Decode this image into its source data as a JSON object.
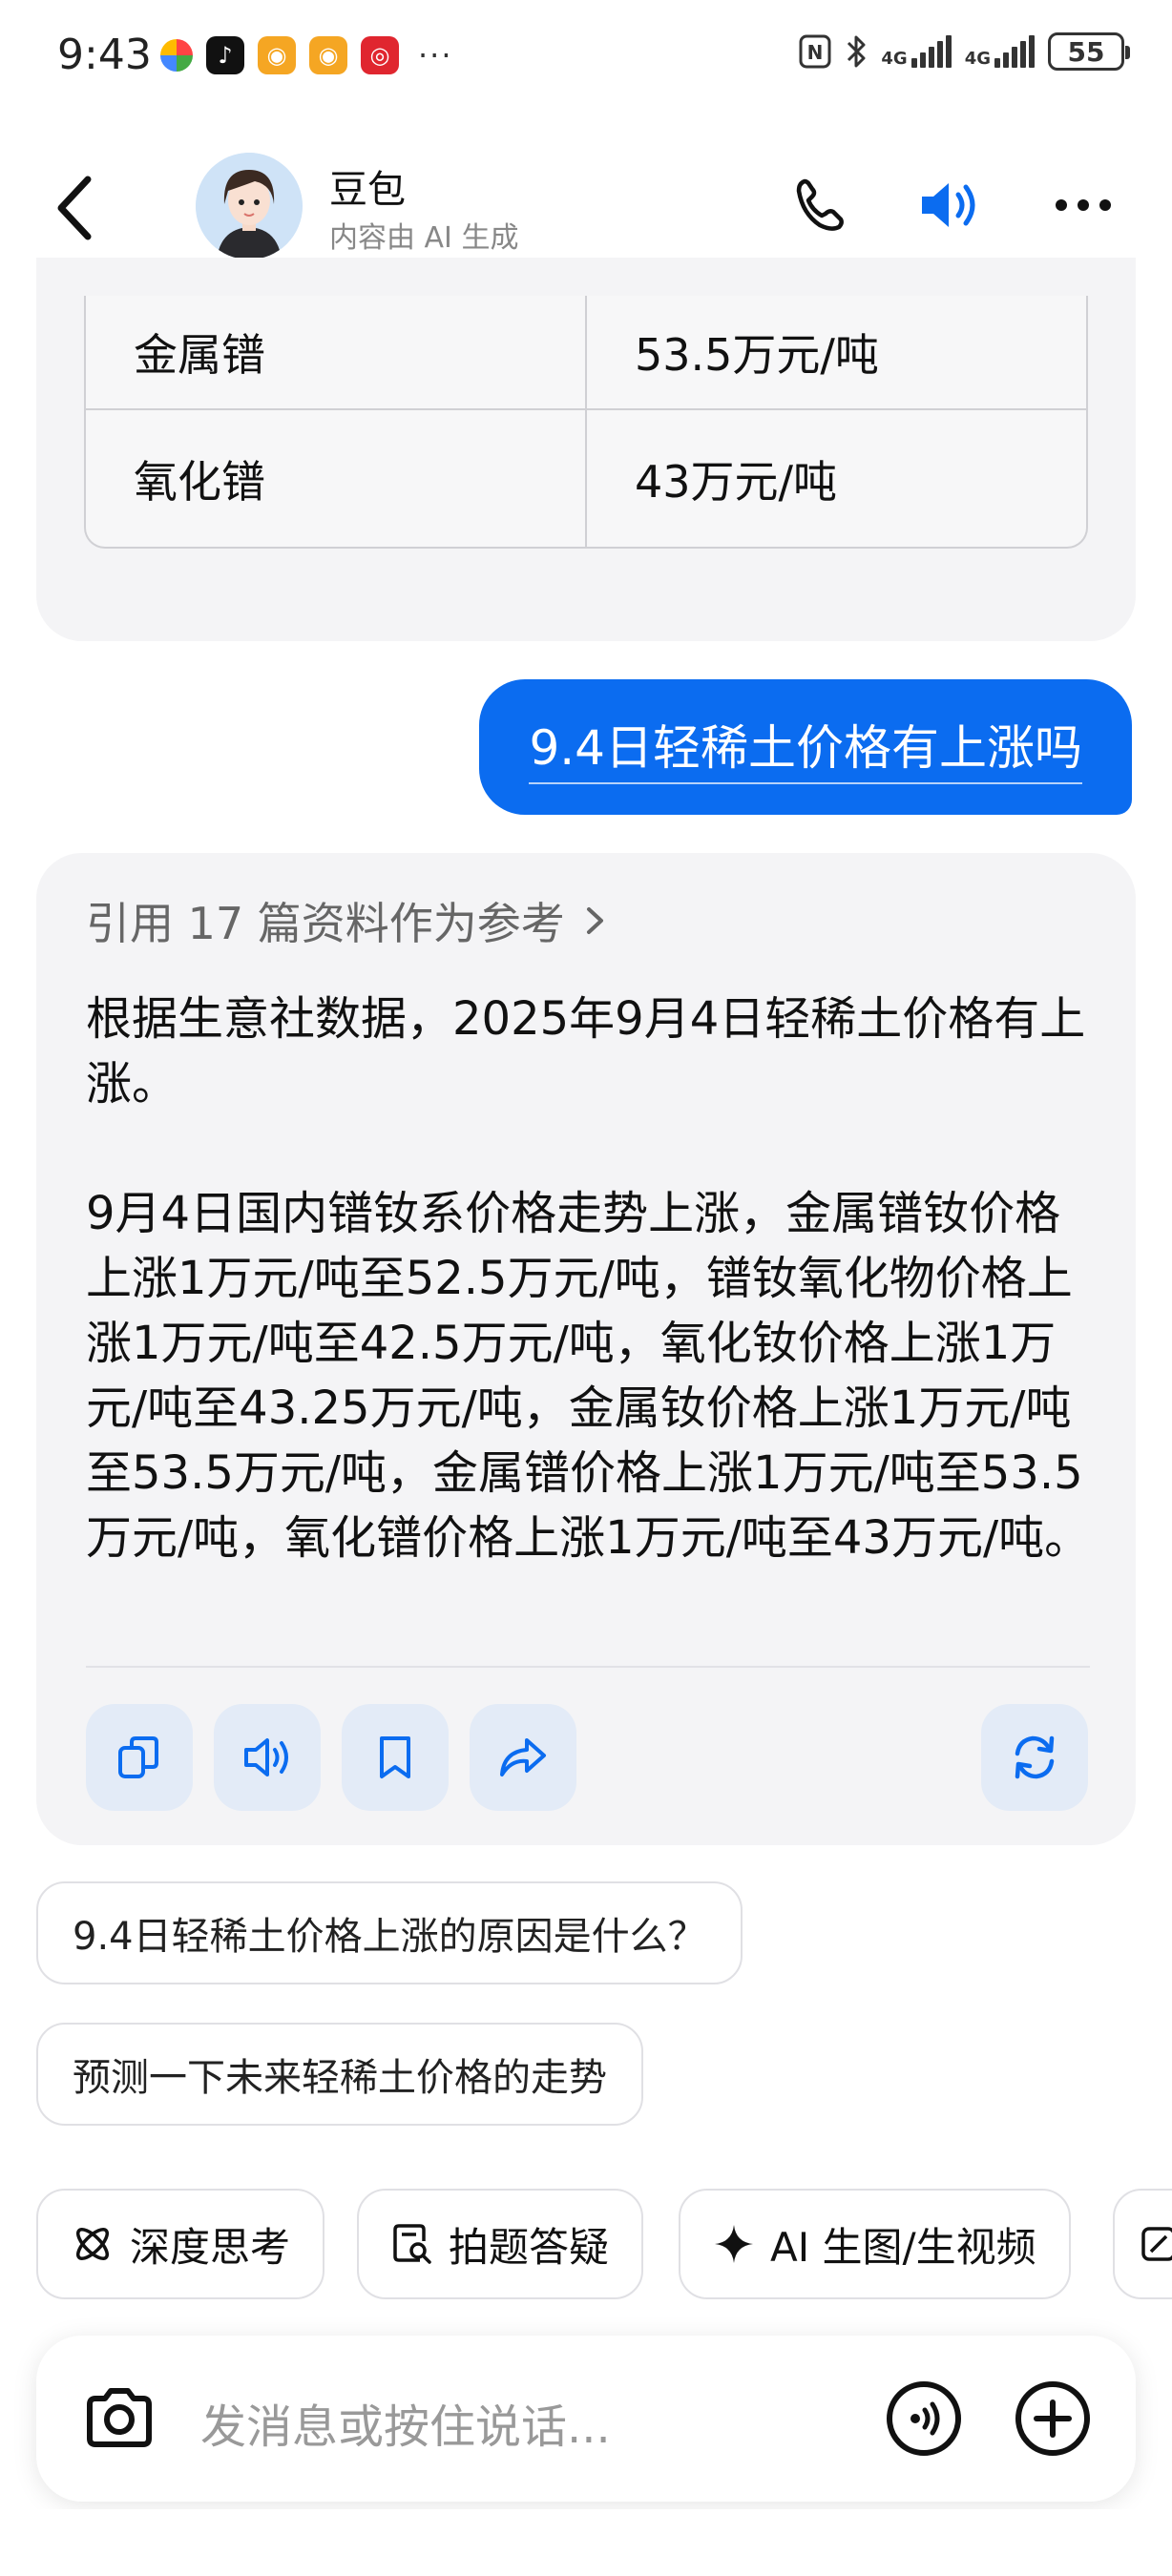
{
  "status_bar": {
    "time": "9:43",
    "more": "···",
    "network_label_1": "4G",
    "network_label_2": "4G",
    "battery": "55"
  },
  "header": {
    "name": "豆包",
    "subtitle": "内容由 AI 生成"
  },
  "price_table": {
    "rows": [
      {
        "name": "金属镨",
        "price": "53.5万元/吨"
      },
      {
        "name": "氧化镨",
        "price": "43万元/吨"
      }
    ]
  },
  "user_message": "9.4日轻稀土价格有上涨吗",
  "answer": {
    "reference": "引用 17 篇资料作为参考",
    "paragraph_1": "根据生意社数据，2025年9月4日轻稀土价格有上涨。",
    "paragraph_2": "9月4日国内镨钕系价格走势上涨，金属镨钕价格上涨1万元/吨至52.5万元/吨，镨钕氧化物价格上涨1万元/吨至42.5万元/吨，氧化钕价格上涨1万元/吨至43.25万元/吨，金属钕价格上涨1万元/吨至53.5万元/吨，金属镨价格上涨1万元/吨至53.5万元/吨，氧化镨价格上涨1万元/吨至43万元/吨。"
  },
  "suggestions": [
    "9.4日轻稀土价格上涨的原因是什么？",
    "预测一下未来轻稀土价格的走势"
  ],
  "tools": {
    "deep_think": "深度思考",
    "photo_answer": "拍题答疑",
    "ai_image_video": "AI 生图/生视频"
  },
  "input": {
    "placeholder": "发消息或按住说话..."
  },
  "colors": {
    "accent": "#0b6cf0",
    "card_bg": "#f4f4f6",
    "action_btn_bg": "#e3ebf7"
  }
}
